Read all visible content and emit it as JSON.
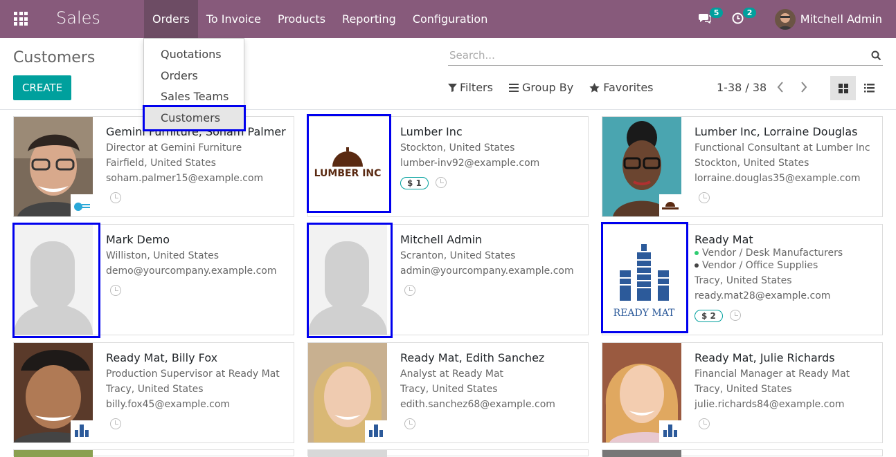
{
  "navbar": {
    "brand": "Sales",
    "menu": [
      "Orders",
      "To Invoice",
      "Products",
      "Reporting",
      "Configuration"
    ],
    "messages_count": "5",
    "activities_count": "2",
    "user_name": "Mitchell Admin",
    "color": "#875a7b"
  },
  "orders_menu": {
    "items": [
      "Quotations",
      "Orders",
      "Sales Teams",
      "Customers"
    ]
  },
  "control_panel": {
    "title": "Customers",
    "create_label": "CREATE",
    "search_placeholder": "Search...",
    "filters_label": "Filters",
    "groupby_label": "Group By",
    "favorites_label": "Favorites",
    "pager": "1-38 / 38"
  },
  "cards": [
    {
      "name": "Gemini Furniture, Soham Palmer",
      "function": "Director at Gemini Furniture",
      "location": "Fairfield, United States",
      "email": "soham.palmer15@example.com"
    },
    {
      "name": "Lumber Inc",
      "location": "Stockton, United States",
      "email": "lumber-inv92@example.com",
      "sales": "$ 1",
      "logo_text": "LUMBER INC"
    },
    {
      "name": "Lumber Inc, Lorraine Douglas",
      "function": "Functional Consultant at Lumber Inc",
      "location": "Stockton, United States",
      "email": "lorraine.douglas35@example.com"
    },
    {
      "name": "Mark Demo",
      "location": "Williston, United States",
      "email": "demo@yourcompany.example.com"
    },
    {
      "name": "Mitchell Admin",
      "location": "Scranton, United States",
      "email": "admin@yourcompany.example.com"
    },
    {
      "name": "Ready Mat",
      "tags": [
        "Vendor / Desk Manufacturers",
        "Vendor / Office Supplies"
      ],
      "location": "Tracy, United States",
      "email": "ready.mat28@example.com",
      "sales": "$ 2",
      "logo_text": "READY MAT"
    },
    {
      "name": "Ready Mat, Billy Fox",
      "function": "Production Supervisor at Ready Mat",
      "location": "Tracy, United States",
      "email": "billy.fox45@example.com"
    },
    {
      "name": "Ready Mat, Edith Sanchez",
      "function": "Analyst at Ready Mat",
      "location": "Tracy, United States",
      "email": "edith.sanchez68@example.com"
    },
    {
      "name": "Ready Mat, Julie Richards",
      "function": "Financial Manager at Ready Mat",
      "location": "Tracy, United States",
      "email": "julie.richards84@example.com"
    }
  ]
}
